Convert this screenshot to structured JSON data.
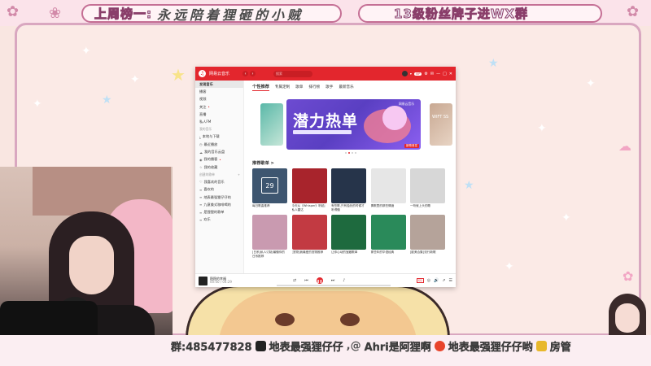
{
  "overlay": {
    "rank_label": "上周榜一:",
    "rank_name": "永远陪着狸砸的小贼",
    "fan_group": "13级粉丝牌子进WX群",
    "social": [
      {
        "icon": "kuaishou-icon",
        "text": "群:485477828"
      },
      {
        "icon": "douyin-icon",
        "text": "地表最强狸仔仔"
      },
      {
        "icon": "at-icon",
        "text": "Ahri是阿狸啊"
      },
      {
        "icon": "weibo-icon",
        "text": "地表最强狸仔仔哟"
      },
      {
        "icon": "admin-icon",
        "text": "房管"
      }
    ]
  },
  "app": {
    "title": "网易云音乐",
    "search_placeholder": "搜索",
    "vip_badge": "VIP",
    "sidebar": {
      "items": [
        {
          "label": "发现音乐",
          "active": true
        },
        {
          "label": "播客"
        },
        {
          "label": "视频"
        },
        {
          "label": "关注"
        },
        {
          "label": "直播"
        },
        {
          "label": "私人FM"
        }
      ],
      "my_music_title": "我的音乐",
      "my_music": [
        {
          "label": "本地与下载"
        },
        {
          "label": "最近播放"
        },
        {
          "label": "我的音乐云盘"
        },
        {
          "label": "我的播客"
        },
        {
          "label": "我的收藏"
        }
      ],
      "playlists_title": "创建的歌单",
      "playlists": [
        {
          "label": "我喜欢的音乐"
        },
        {
          "label": "喜欢的"
        },
        {
          "label": "地表最强狸仔仔的"
        },
        {
          "label": "九意美式咖啡喝的"
        },
        {
          "label": "是狸狸的歌单"
        },
        {
          "label": "欢乐"
        }
      ]
    },
    "tabs": [
      "个性推荐",
      "专属定制",
      "歌单",
      "排行榜",
      "歌手",
      "最新音乐"
    ],
    "banner": {
      "title": "潜力热单",
      "brand": "网易云音乐",
      "tag": "新歌首发",
      "right_label": "WIFT SS"
    },
    "section_title": "推荐歌单 >",
    "playlists": [
      {
        "caption": "每日歌曲推荐",
        "color": "#3e5670",
        "badge": "29"
      },
      {
        "caption": "今天从《Whisper》听起|私人雷达",
        "color": "#a8242c"
      },
      {
        "caption": "有些歌,只有独处的时候才听得懂",
        "color": "#26344a"
      },
      {
        "caption": "情歌里的那些情绪",
        "color": "#e6e6e6"
      },
      {
        "caption": "一听就上头的歌",
        "color": "#d7d7d7"
      },
      {
        "caption": "[日系]私人订制|最懂你的日系推荐",
        "color": "#c99ab0"
      },
      {
        "caption": "[宠物]我最爱的宠物推荐",
        "color": "#c23a42"
      },
      {
        "caption": "让你心动的宝藏歌单",
        "color": "#1e6a3e"
      },
      {
        "caption": "那些年的华语经典",
        "color": "#2a8a5a"
      },
      {
        "caption": "[欧美合集]流行新歌",
        "color": "#b5a39a"
      }
    ],
    "player": {
      "song": "稳稳的幸福",
      "time": "00:00 / 04:29"
    }
  }
}
